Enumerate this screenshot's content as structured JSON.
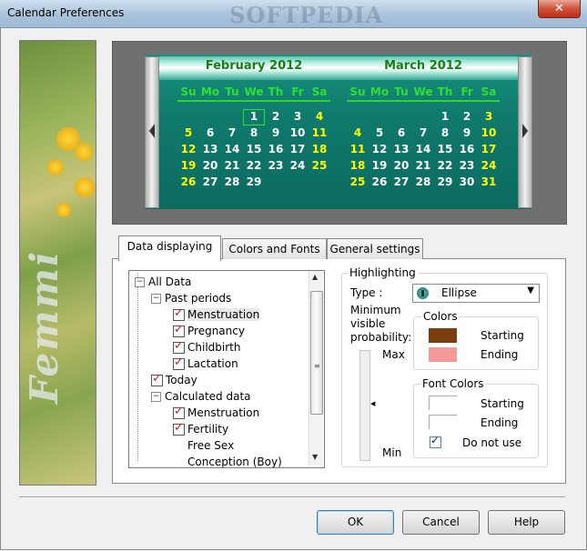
{
  "window": {
    "title": "Calendar Preferences",
    "watermark": "SOFTPEDIA",
    "close_glyph": "✕"
  },
  "sidebar": {
    "logo_text": "Femmi"
  },
  "calendar": {
    "months": [
      {
        "title": "February 2012",
        "weekdays": [
          "Su",
          "Mo",
          "Tu",
          "We",
          "Th",
          "Fr",
          "Sa"
        ],
        "weeks": [
          [
            "",
            "",
            "",
            "1",
            "2",
            "3",
            "4"
          ],
          [
            "5",
            "6",
            "7",
            "8",
            "9",
            "10",
            "11"
          ],
          [
            "12",
            "13",
            "14",
            "15",
            "16",
            "17",
            "18"
          ],
          [
            "19",
            "20",
            "21",
            "22",
            "23",
            "24",
            "25"
          ],
          [
            "26",
            "27",
            "28",
            "29",
            "",
            "",
            ""
          ]
        ],
        "today": "1"
      },
      {
        "title": "March 2012",
        "weekdays": [
          "Su",
          "Mo",
          "Tu",
          "We",
          "Th",
          "Fr",
          "Sa"
        ],
        "weeks": [
          [
            "",
            "",
            "",
            "",
            "1",
            "2",
            "3"
          ],
          [
            "4",
            "5",
            "6",
            "7",
            "8",
            "9",
            "10"
          ],
          [
            "11",
            "12",
            "13",
            "14",
            "15",
            "16",
            "17"
          ],
          [
            "18",
            "19",
            "20",
            "21",
            "22",
            "23",
            "24"
          ],
          [
            "25",
            "26",
            "27",
            "28",
            "29",
            "30",
            "31"
          ]
        ],
        "today": ""
      }
    ],
    "colors": {
      "weekday_header": "#2fe02f",
      "weekend_day": "#ffff00",
      "day": "#ffffff",
      "month_title": "#1c7d16"
    }
  },
  "tabs": [
    {
      "label": "Data displaying",
      "active": true
    },
    {
      "label": "Colors and Fonts",
      "active": false
    },
    {
      "label": "General settings",
      "active": false
    }
  ],
  "tree": {
    "items": [
      {
        "label": "All Data",
        "level": 0,
        "type": "expander",
        "checked": false
      },
      {
        "label": "Past periods",
        "level": 1,
        "type": "expander",
        "checked": false
      },
      {
        "label": "Menstruation",
        "level": 2,
        "type": "check",
        "checked": true,
        "selected": true
      },
      {
        "label": "Pregnancy",
        "level": 2,
        "type": "check",
        "checked": true
      },
      {
        "label": "Childbirth",
        "level": 2,
        "type": "check",
        "checked": true
      },
      {
        "label": "Lactation",
        "level": 2,
        "type": "check",
        "checked": true
      },
      {
        "label": "Today",
        "level": 1,
        "type": "check",
        "checked": true
      },
      {
        "label": "Calculated data",
        "level": 1,
        "type": "expander",
        "checked": false
      },
      {
        "label": "Menstruation",
        "level": 2,
        "type": "check",
        "checked": true
      },
      {
        "label": "Fertility",
        "level": 2,
        "type": "check",
        "checked": true
      },
      {
        "label": "Free Sex",
        "level": 2,
        "type": "none",
        "checked": false
      },
      {
        "label": "Conception (Boy)",
        "level": 2,
        "type": "none",
        "checked": false
      }
    ]
  },
  "highlighting": {
    "group_label": "Highlighting",
    "type_label": "Type :",
    "type_value": "Ellipse",
    "min_prob_label_1": "Minimum",
    "min_prob_label_2": "visible",
    "min_prob_label_3": "probability:",
    "max_label": "Max",
    "min_label": "Min",
    "colors_group": "Colors",
    "starting_label": "Starting",
    "ending_label": "Ending",
    "color_starting": "#7a3d0e",
    "color_ending": "#f59a9a",
    "font_colors_group": "Font Colors",
    "font_starting_label": "Starting",
    "font_ending_label": "Ending",
    "do_not_use_label": "Do not use",
    "do_not_use_checked": true
  },
  "buttons": {
    "ok": "OK",
    "cancel": "Cancel",
    "help": "Help"
  }
}
